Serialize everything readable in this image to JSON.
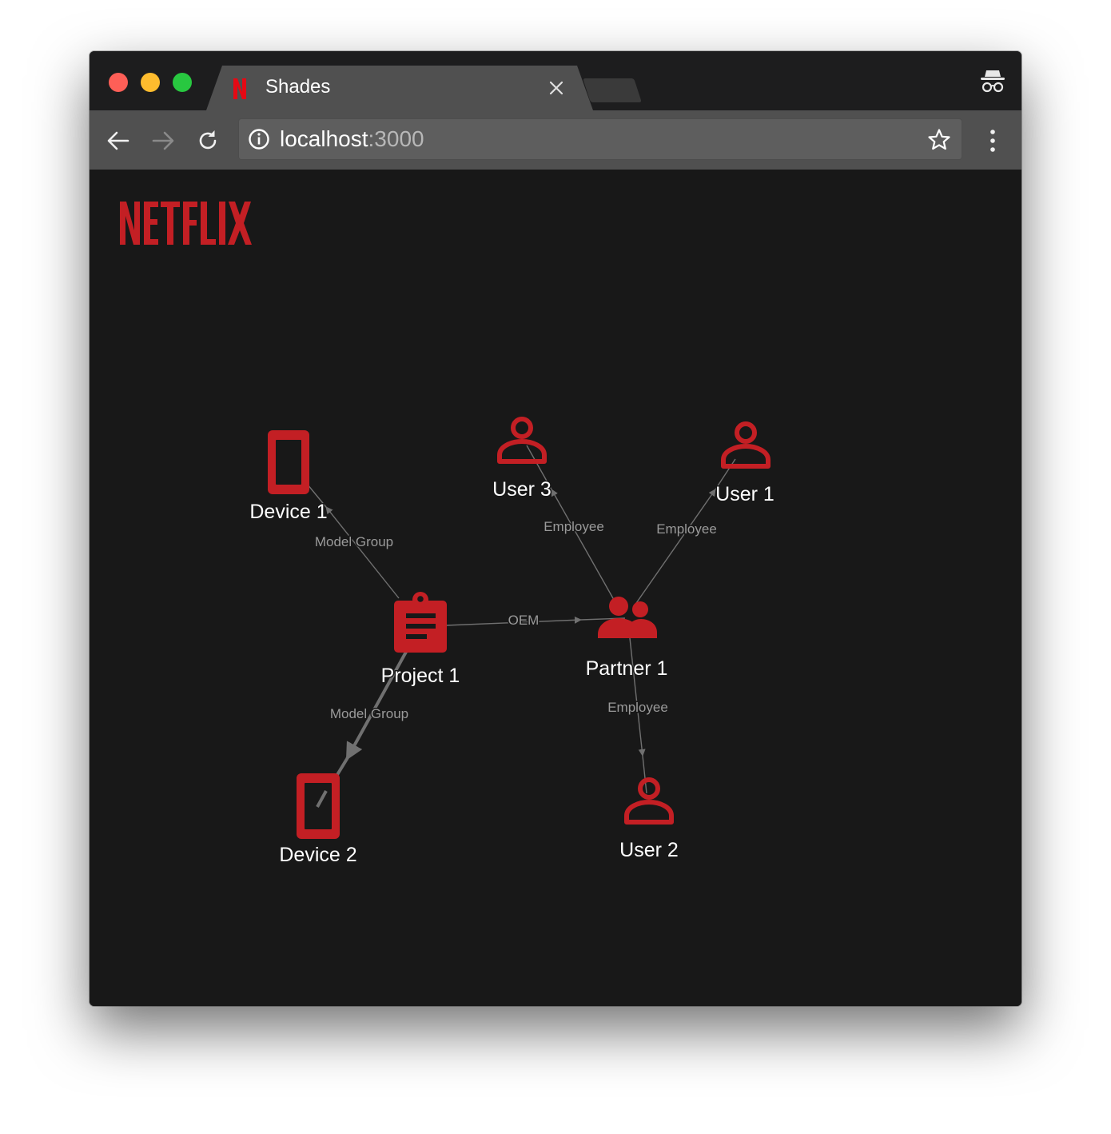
{
  "window": {
    "tab": {
      "title": "Shades",
      "favicon": "netflix-n-icon"
    },
    "address": {
      "host": "localhost",
      "port": ":3000"
    }
  },
  "brand": {
    "logo_text": "NETFLIX",
    "color": "#c31f24"
  },
  "colors": {
    "background": "#181818",
    "node": "#c31f24",
    "edge": "#707070",
    "edge_label": "#9a9a9a",
    "node_label": "#ffffff"
  },
  "graph": {
    "nodes": {
      "device1": {
        "label": "Device 1",
        "icon": "tablet-icon"
      },
      "device2": {
        "label": "Device 2",
        "icon": "tablet-icon"
      },
      "project1": {
        "label": "Project 1",
        "icon": "clipboard-icon"
      },
      "partner1": {
        "label": "Partner 1",
        "icon": "group-icon"
      },
      "user1": {
        "label": "User 1",
        "icon": "person-icon"
      },
      "user2": {
        "label": "User 2",
        "icon": "person-icon"
      },
      "user3": {
        "label": "User 3",
        "icon": "person-icon"
      }
    },
    "edges": [
      {
        "from": "project1",
        "to": "device1",
        "label": "Model Group"
      },
      {
        "from": "project1",
        "to": "device2",
        "label": "Model Group"
      },
      {
        "from": "project1",
        "to": "partner1",
        "label": "OEM"
      },
      {
        "from": "partner1",
        "to": "user3",
        "label": "Employee"
      },
      {
        "from": "partner1",
        "to": "user1",
        "label": "Employee"
      },
      {
        "from": "partner1",
        "to": "user2",
        "label": "Employee"
      }
    ]
  }
}
